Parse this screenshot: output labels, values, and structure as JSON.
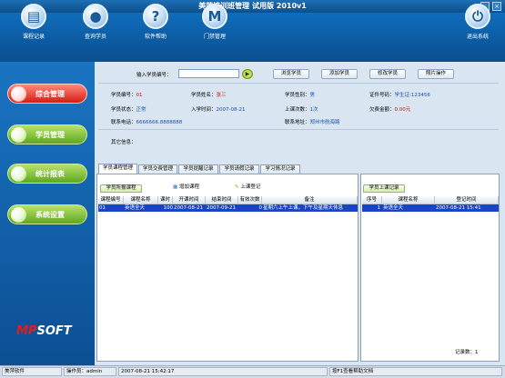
{
  "window": {
    "title": "美萍培训班管理 试用版 2010v1",
    "min": "_",
    "close": "×"
  },
  "toolbar": [
    {
      "label": "课程记录",
      "icon": "document-icon",
      "glyph": "▤"
    },
    {
      "label": "查询学员",
      "icon": "person-icon",
      "glyph": "●"
    },
    {
      "label": "软件帮助",
      "icon": "help-icon",
      "glyph": "?"
    },
    {
      "label": "门禁管理",
      "icon": "m-icon",
      "glyph": "M"
    },
    {
      "label": "退出系统",
      "icon": "power-icon",
      "glyph": "⏻"
    }
  ],
  "sidebar": [
    {
      "label": "综合管理",
      "active": true
    },
    {
      "label": "学员管理",
      "active": false
    },
    {
      "label": "统计报表",
      "active": false
    },
    {
      "label": "系统设置",
      "active": false
    }
  ],
  "brand": {
    "logo_a": "MP",
    "logo_b": "SOFT"
  },
  "search": {
    "label": "输入学员编号：",
    "value": "",
    "go": "▶"
  },
  "actions": [
    "浏览学员",
    "添加学员",
    "修改学员",
    "照片操作"
  ],
  "info": {
    "id_label": "学员编号：",
    "id_value": "01",
    "name_label": "学员姓名：",
    "name_value": "张三",
    "gender_label": "学员性别：",
    "gender_value": "男",
    "cert_label": "证件号码：",
    "cert_value": "学生证:123456",
    "status_label": "学员状态：",
    "status_value": "正常",
    "date_label": "入学时间：",
    "date_value": "2007-08-21",
    "count_label": "上课次数：",
    "count_value": "1次",
    "owe_label": "欠费金额：",
    "owe_value": "0.00元",
    "phone_label": "联系电话：",
    "phone_value": "6666666.8888888",
    "addr_label": "联系地址：",
    "addr_value": "郑州市航海路",
    "other_label": "其它信息："
  },
  "tabs": [
    "学员课程管理",
    "学员交费管理",
    "学员提醒记录",
    "学员请假记录",
    "学习情况记录"
  ],
  "left_panel": {
    "subtab": "学员所报课程",
    "add": "增加课程",
    "checkin": "上课登记",
    "headers": [
      "课程编号",
      "课程名称",
      "课时",
      "开课时间",
      "结束时间",
      "有效次数",
      "备注"
    ],
    "rows": [
      [
        "01",
        "英语全天",
        "100",
        "2007-08-21",
        "2007-09-21",
        "0",
        "星期六上午上课，下午及星期天休息"
      ]
    ]
  },
  "right_panel": {
    "subtab": "学员上课记录",
    "headers": [
      "序号",
      "课程名称",
      "登记时间"
    ],
    "rows": [
      [
        "1",
        "英语全天",
        "2007-08-21 15:41"
      ]
    ],
    "footer": "记录数：1"
  },
  "status": {
    "company": "美萍软件",
    "operator": "操作员：admin",
    "time": "2007-08-21 15:42:17",
    "hint": "按F1查看帮助文档"
  }
}
